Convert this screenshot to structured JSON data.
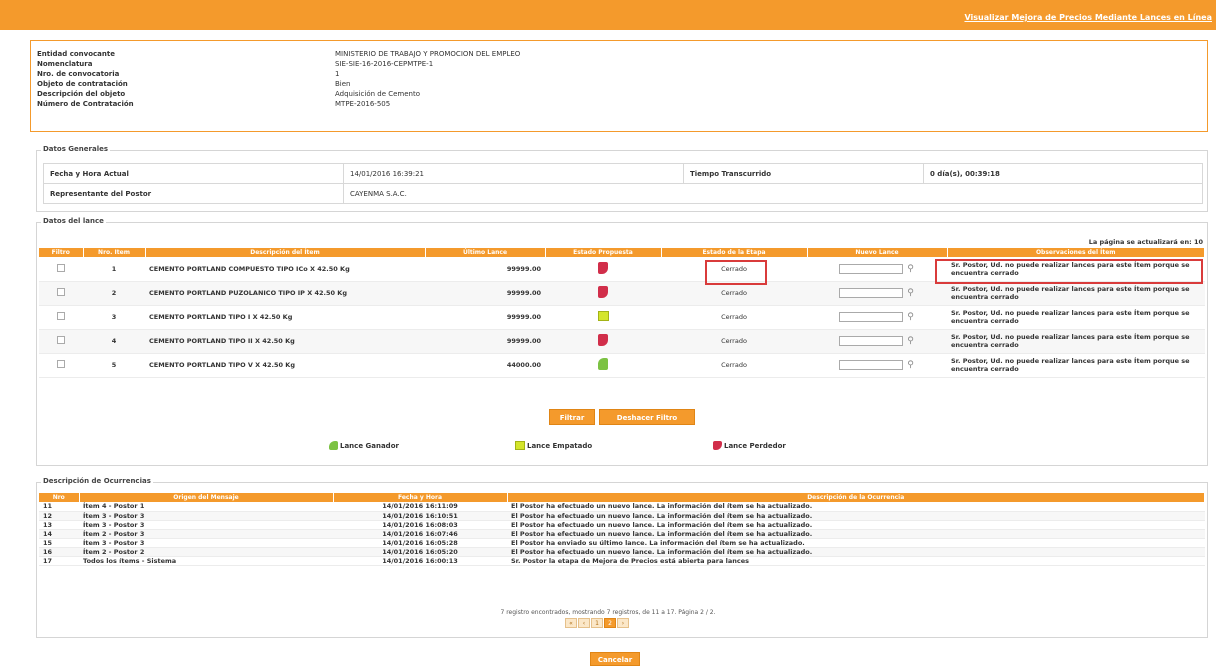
{
  "header": {
    "title": "Visualizar Mejora de Precios Mediante Lances en Línea"
  },
  "info": [
    {
      "label": "Entidad convocante",
      "value": "MINISTERIO DE TRABAJO Y PROMOCION DEL EMPLEO"
    },
    {
      "label": "Nomenclatura",
      "value": "SIE-SIE-16-2016-CEPMTPE-1"
    },
    {
      "label": "Nro. de convocatoria",
      "value": "1"
    },
    {
      "label": "Objeto de contratación",
      "value": "Bien"
    },
    {
      "label": "Descripción del objeto",
      "value": "Adquisición de Cemento"
    },
    {
      "label": "Número de Contratación",
      "value": "MTPE-2016-505"
    }
  ],
  "datos_generales": {
    "legend": "Datos Generales",
    "fecha_label": "Fecha y Hora Actual",
    "fecha_value": "14/01/2016 16:39:21",
    "tiempo_label": "Tiempo Transcurrido",
    "tiempo_value": "0 día(s), 00:39:18",
    "rep_label": "Representante del Postor",
    "rep_value": "CAYENMA S.A.C."
  },
  "datos_lance": {
    "legend": "Datos del lance",
    "refresh_note": "La página se actualizará en: 10",
    "columns": [
      "Filtro",
      "Nro. Item",
      "Descripción del Ítem",
      "Último Lance",
      "Estado Propuesta",
      "Estado de la Etapa",
      "Nuevo Lance",
      "Observaciones del Ítem"
    ],
    "rows": [
      {
        "nro": "1",
        "desc": "CEMENTO PORTLAND COMPUESTO TIPO ICo X 42.50 Kg",
        "ultimo": "99999.00",
        "estado": "down",
        "etapa": "Cerrado",
        "obs": "Sr. Postor, Ud. no puede realizar lances para este Ítem porque se encuentra cerrado"
      },
      {
        "nro": "2",
        "desc": "CEMENTO PORTLAND PUZOLANICO TIPO IP X 42.50 Kg",
        "ultimo": "99999.00",
        "estado": "down",
        "etapa": "Cerrado",
        "obs": "Sr. Postor, Ud. no puede realizar lances para este Ítem porque se encuentra cerrado"
      },
      {
        "nro": "3",
        "desc": "CEMENTO PORTLAND TIPO I X 42.50 Kg",
        "ultimo": "99999.00",
        "estado": "tie",
        "etapa": "Cerrado",
        "obs": "Sr. Postor, Ud. no puede realizar lances para este Ítem porque se encuentra cerrado"
      },
      {
        "nro": "4",
        "desc": "CEMENTO PORTLAND TIPO II X 42.50 Kg",
        "ultimo": "99999.00",
        "estado": "down",
        "etapa": "Cerrado",
        "obs": "Sr. Postor, Ud. no puede realizar lances para este Ítem porque se encuentra cerrado"
      },
      {
        "nro": "5",
        "desc": "CEMENTO PORTLAND TIPO V X 42.50 Kg",
        "ultimo": "44000.00",
        "estado": "up",
        "etapa": "Cerrado",
        "obs": "Sr. Postor, Ud. no puede realizar lances para este Ítem porque se encuentra cerrado"
      }
    ],
    "filter_button": "Filtrar",
    "clear_button": "Deshacer Filtro",
    "legend_items": {
      "ganador": "Lance Ganador",
      "empatado": "Lance Empatado",
      "perdedor": "Lance Perdedor"
    }
  },
  "ocurrencias": {
    "legend": "Descripción de Ocurrencias",
    "columns": [
      "Nro",
      "Origen del Mensaje",
      "Fecha y Hora",
      "Descripción de la Ocurrencia"
    ],
    "rows": [
      {
        "nro": "11",
        "origen": "Ítem 4 - Postor 1",
        "fecha": "14/01/2016 16:11:09",
        "desc": "El Postor ha efectuado un nuevo lance. La información del ítem se ha actualizado."
      },
      {
        "nro": "12",
        "origen": "Ítem 3 - Postor 3",
        "fecha": "14/01/2016 16:10:51",
        "desc": "El Postor ha efectuado un nuevo lance. La información del ítem se ha actualizado."
      },
      {
        "nro": "13",
        "origen": "Ítem 3 - Postor 3",
        "fecha": "14/01/2016 16:08:03",
        "desc": "El Postor ha efectuado un nuevo lance. La información del ítem se ha actualizado."
      },
      {
        "nro": "14",
        "origen": "Ítem 2 - Postor 3",
        "fecha": "14/01/2016 16:07:46",
        "desc": "El Postor ha efectuado un nuevo lance. La información del ítem se ha actualizado."
      },
      {
        "nro": "15",
        "origen": "Ítem 3 - Postor 3",
        "fecha": "14/01/2016 16:05:28",
        "desc": "El Postor ha enviado su último lance. La información del ítem se ha actualizado."
      },
      {
        "nro": "16",
        "origen": "Ítem 2 - Postor 2",
        "fecha": "14/01/2016 16:05:20",
        "desc": "El Postor ha efectuado un nuevo lance. La información del ítem se ha actualizado."
      },
      {
        "nro": "17",
        "origen": "Todos los ítems - Sistema",
        "fecha": "14/01/2016 16:00:13",
        "desc": "Sr. Postor la etapa de Mejora de Precios está abierta para lances"
      }
    ],
    "pager_text": "7 registro encontrados, mostrando 7 registros, de 11 a 17. Página 2 / 2.",
    "pages": [
      "«",
      "‹",
      "1",
      "2",
      "›"
    ]
  },
  "footer": {
    "cancel_button": "Cancelar"
  }
}
